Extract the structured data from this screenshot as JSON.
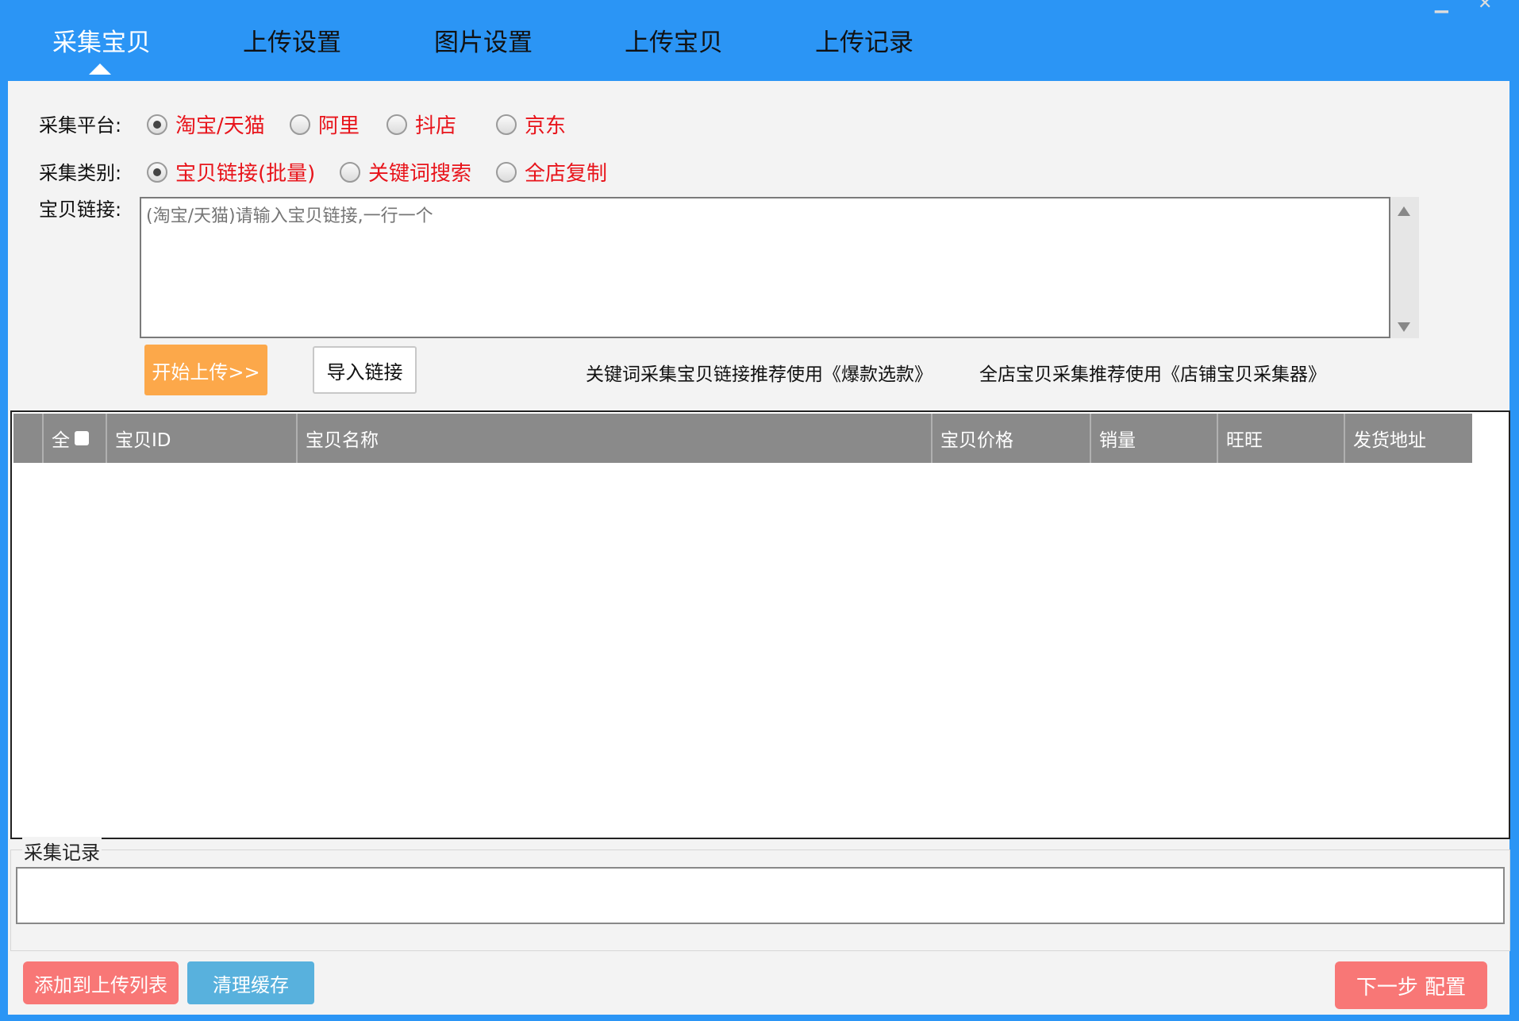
{
  "tabs": [
    {
      "label": "采集宝贝",
      "active": true
    },
    {
      "label": "上传设置"
    },
    {
      "label": "图片设置"
    },
    {
      "label": "上传宝贝"
    },
    {
      "label": "上传记录"
    }
  ],
  "window_controls": {
    "minimize": "▁",
    "close": "✕"
  },
  "platform": {
    "label": "采集平台:",
    "options": [
      "淘宝/天猫",
      "阿里",
      "抖店",
      "京东"
    ],
    "selected": "淘宝/天猫"
  },
  "category": {
    "label": "采集类别:",
    "options": [
      "宝贝链接(批量)",
      "关键词搜索",
      "全店复制"
    ],
    "selected": "宝贝链接(批量)"
  },
  "links": {
    "label": "宝贝链接:",
    "placeholder": "(淘宝/天猫)请输入宝贝链接,一行一个",
    "value": ""
  },
  "buttons": {
    "start": "开始上传>>",
    "import": "导入链接",
    "add_to_upload": "添加到上传列表",
    "clear_cache": "清理缓存",
    "next": "下一步 配置"
  },
  "tips": [
    "关键词采集宝贝链接推荐使用《爆款选款》",
    "全店宝贝采集推荐使用《店铺宝贝采集器》"
  ],
  "table": {
    "select_all_label": "全",
    "columns": [
      "宝贝ID",
      "宝贝名称",
      "宝贝价格",
      "销量",
      "旺旺",
      "发货地址"
    ],
    "rows": []
  },
  "record": {
    "title": "采集记录",
    "value": ""
  },
  "colors": {
    "accent_blue": "#2b95f5",
    "option_red": "#e8141b",
    "start_orange": "#fca84a",
    "action_red": "#f87776",
    "clear_blue": "#58b1dd",
    "header_gray": "#8a8a8a"
  }
}
